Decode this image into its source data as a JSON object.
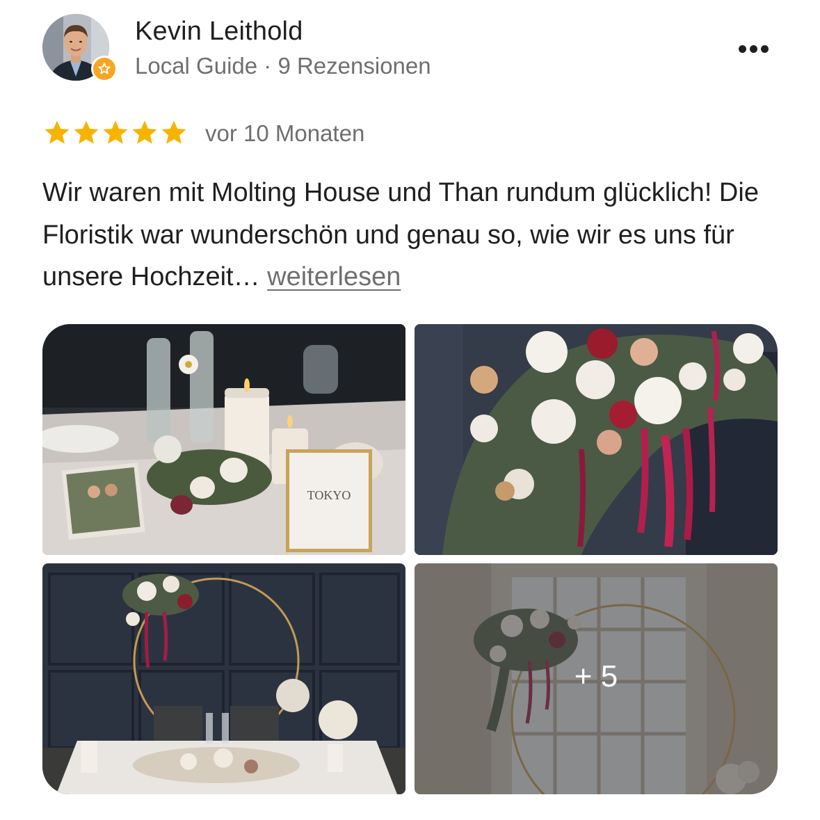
{
  "review": {
    "author_name": "Kevin Leithold",
    "author_meta": "Local Guide · 9 Rezensionen",
    "rating": 5,
    "max_rating": 5,
    "date": "vor 10 Monaten",
    "text": "Wir waren mit Molting House und Than rundum glücklich! Die Floristik war wunderschön und genau so, wie wir es uns für unsere Hochzeit…",
    "read_more_label": "weiterlesen"
  },
  "photos": {
    "extra_count_label": "+ 5",
    "table_card_label": "TOKYO"
  },
  "colors": {
    "star": "#f6b400",
    "badge": "#f5a623",
    "text": "#1f1f1f",
    "muted": "#6f6f6f"
  },
  "icons": {
    "badge": "local-guide-star-icon",
    "more": "more-horizontal-icon",
    "star": "star-filled-icon"
  }
}
